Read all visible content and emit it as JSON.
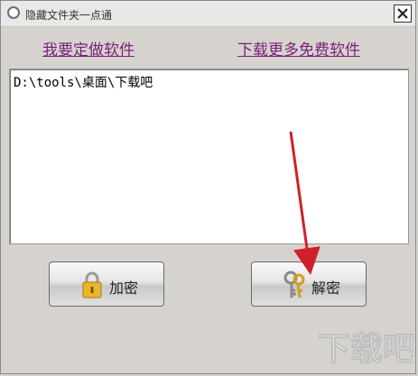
{
  "window": {
    "title": "隐藏文件夹一点通"
  },
  "links": {
    "custom_software": "我要定做软件",
    "download_free": "下载更多免费软件"
  },
  "folder_path": "D:\\tools\\桌面\\下载吧",
  "buttons": {
    "encrypt": "加密",
    "decrypt": "解密"
  },
  "icons": {
    "title": "app-icon",
    "close": "close-icon",
    "encrypt": "padlock-icon",
    "decrypt": "keys-icon"
  },
  "colors": {
    "link": "#7a1f7a",
    "arrow": "#d0202a"
  },
  "watermark": {
    "text": "下载吧"
  }
}
